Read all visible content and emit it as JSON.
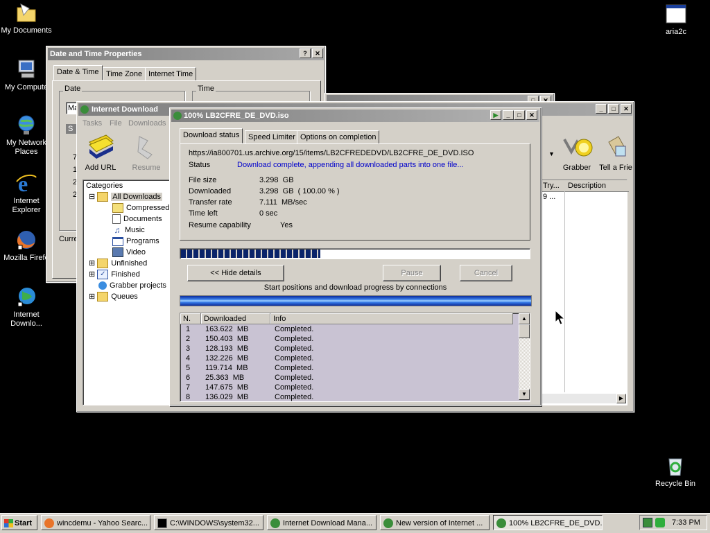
{
  "desktop": {
    "icons": {
      "my_documents": "My Documents",
      "my_computer": "My Compute",
      "my_network": "My Network Places",
      "internet_explorer": "Internet Explorer",
      "mozilla": "Mozilla Firefo",
      "idm": "Internet Downlo...",
      "aria2c": "aria2c",
      "recycle_bin": "Recycle Bin"
    }
  },
  "datetime_window": {
    "title": "Date and Time Properties",
    "tabs": [
      "Date & Time",
      "Time Zone",
      "Internet Time"
    ],
    "date_group": "Date",
    "time_group": "Time",
    "month_partial": "Ma",
    "current_partial": "Curre",
    "cal_partial": [
      "S",
      "7",
      "1",
      "2",
      "2"
    ]
  },
  "idm_main": {
    "title": "Internet Download",
    "menu": [
      "Tasks",
      "File",
      "Downloads"
    ],
    "toolbar": {
      "add_url": "Add URL",
      "resume": "Resume",
      "grabber": "Grabber",
      "tell_friend": "Tell a Frie"
    },
    "categories_label": "Categories",
    "tree": {
      "all_downloads": "All Downloads",
      "compressed": "Compressed",
      "documents": "Documents",
      "music": "Music",
      "programs": "Programs",
      "video": "Video",
      "unfinished": "Unfinished",
      "finished": "Finished",
      "grabber_projects": "Grabber projects",
      "queues": "Queues"
    },
    "columns": {
      "try": "Try...",
      "description": "Description"
    },
    "row_partial": "9 ..."
  },
  "progress_dialog": {
    "title": "100% LB2CFRE_DE_DVD.iso",
    "tabs": [
      "Download status",
      "Speed Limiter",
      "Options on completion"
    ],
    "url": "https://ia800701.us.archive.org/15/items/LB2CFREDEDVD/LB2CFRE_DE_DVD.ISO",
    "status_label": "Status",
    "status_value": "Download complete, appending all downloaded parts into one file...",
    "file_size_label": "File size",
    "file_size_value": "3.298  GB",
    "downloaded_label": "Downloaded",
    "downloaded_value": "3.298  GB  ( 100.00 % )",
    "transfer_rate_label": "Transfer rate",
    "transfer_rate_value": "7.111  MB/sec",
    "time_left_label": "Time left",
    "time_left_value": "0 sec",
    "resume_label": "Resume capability",
    "resume_value": "Yes",
    "progress_fraction": 0.4,
    "hide_details": "<< Hide details",
    "pause": "Pause",
    "cancel": "Cancel",
    "connections_caption": "Start positions and download progress by connections",
    "table": {
      "headers": [
        "N.",
        "Downloaded",
        "Info"
      ],
      "rows": [
        [
          "1",
          "163.622  MB",
          "Completed."
        ],
        [
          "2",
          "150.403  MB",
          "Completed."
        ],
        [
          "3",
          "128.193  MB",
          "Completed."
        ],
        [
          "4",
          "132.226  MB",
          "Completed."
        ],
        [
          "5",
          "119.714  MB",
          "Completed."
        ],
        [
          "6",
          "25.363  MB",
          "Completed."
        ],
        [
          "7",
          "147.675  MB",
          "Completed."
        ],
        [
          "8",
          "136.029  MB",
          "Completed."
        ]
      ]
    }
  },
  "taskbar": {
    "start": "Start",
    "buttons": [
      "wincdemu - Yahoo Searc...",
      "C:\\WINDOWS\\system32...",
      "Internet Download Mana...",
      "New version of Internet ...",
      "100% LB2CFRE_DE_DVD...."
    ],
    "clock": "7:33 PM"
  },
  "colors": {
    "status_blue": "#0000cc",
    "progress_navy": "#0a246a",
    "connections_bar": "#1e6fd9"
  }
}
